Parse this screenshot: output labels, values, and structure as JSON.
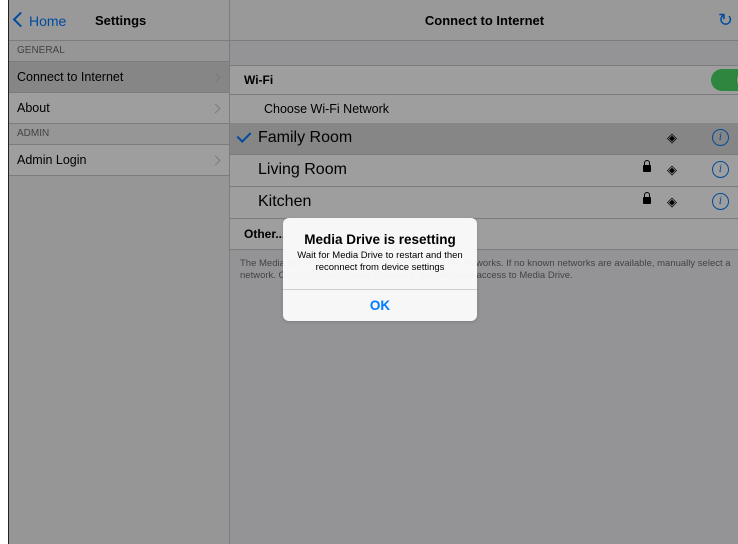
{
  "sidebar": {
    "back_label": "Home",
    "title": "Settings",
    "sections": [
      {
        "header": "GENERAL",
        "items": [
          "Connect to Internet",
          "About"
        ]
      },
      {
        "header": "ADMIN",
        "items": [
          "Admin Login"
        ]
      }
    ]
  },
  "main": {
    "title": "Connect to Internet",
    "wifi_label": "Wi-Fi",
    "wifi_enabled": true,
    "choose_label": "Choose Wi-Fi Network",
    "networks": [
      {
        "name": "Family Room",
        "connected": true,
        "locked": false
      },
      {
        "name": "Living Room",
        "connected": false,
        "locked": true
      },
      {
        "name": "Kitchen",
        "connected": false,
        "locked": true
      }
    ],
    "other_label": "Other...",
    "note_line1": "The Media Drive will connect automatically to known networks. If no known networks are available, manually select a",
    "note_line2": "network. Once you have joined a network, you will have access to Media Drive.",
    "info_glyph": "i"
  },
  "alert": {
    "title": "Media Drive is resetting",
    "message": "Wait for Media Drive to restart and then reconnect from device settings",
    "ok_label": "OK"
  },
  "colors": {
    "accent": "#007aff",
    "toggle_on": "#4cd964"
  }
}
